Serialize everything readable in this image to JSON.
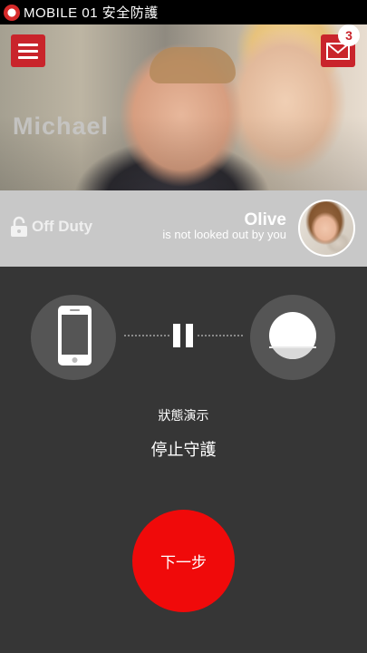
{
  "status_bar": {
    "text": "MOBILE 01 安全防護"
  },
  "hero": {
    "user_name": "Michael",
    "unread_count": "3",
    "menu_icon": "hamburger-menu-icon",
    "mail_icon": "envelope-icon"
  },
  "status_panel": {
    "duty_label": "Off Duty",
    "person_name": "Olive",
    "person_status": "is not looked out by you",
    "lock_icon": "unlocked-padlock-icon"
  },
  "devices": {
    "left_icon": "smartphone-icon",
    "right_icon": "sensor-icon",
    "connection_icon": "pause-icon"
  },
  "demo": {
    "title": "狀態演示",
    "state": "停止守護"
  },
  "next_button": {
    "label": "下一步"
  },
  "colors": {
    "accent_red": "#c9242b",
    "next_button_red": "#f00a0a",
    "background": "#363636",
    "panel_gray": "#c8c8c8"
  }
}
